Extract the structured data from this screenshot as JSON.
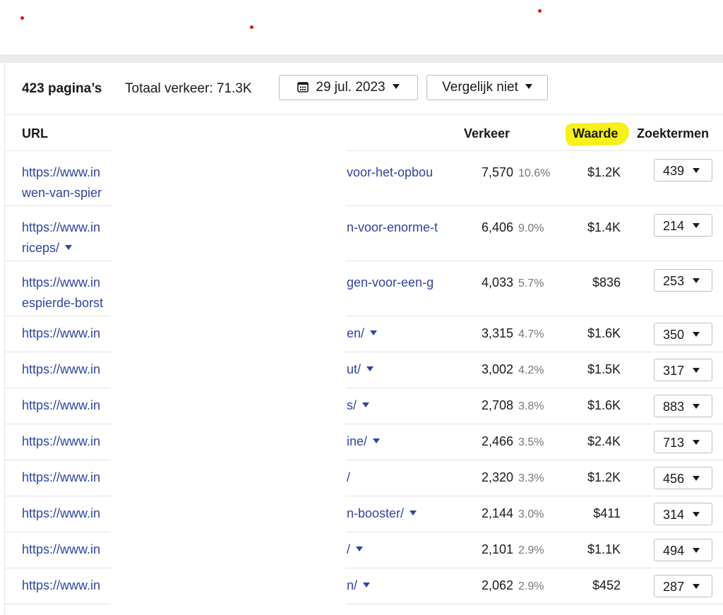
{
  "toolbar": {
    "pages_count": "423 pagina’s",
    "total_traffic": "Totaal verkeer: 71.3K",
    "date": "29 jul. 2023",
    "compare": "Vergelijk niet",
    "date_icon": "calendar-icon",
    "dropdown_icon": "caret-down-icon"
  },
  "table": {
    "headers": {
      "url": "URL",
      "traffic": "Verkeer",
      "value": "Waarde",
      "keywords": "Zoektermen"
    },
    "rows": [
      {
        "url_start": "https://www.in",
        "url_start_2": "wen-van-spier",
        "url_end": "voor-het-opbou",
        "traffic": "7,570",
        "pct": "10.6%",
        "value": "$1.2K",
        "keywords": "439"
      },
      {
        "url_start": "https://www.in",
        "url_start_2": "riceps/",
        "url_end": "n-voor-enorme-t",
        "traffic": "6,406",
        "pct": "9.0%",
        "value": "$1.4K",
        "keywords": "214"
      },
      {
        "url_start": "https://www.in",
        "url_start_2": "espierde-borst",
        "url_end": "gen-voor-een-g",
        "traffic": "4,033",
        "pct": "5.7%",
        "value": "$836",
        "keywords": "253"
      },
      {
        "url_start": "https://www.in",
        "url_end": "en/",
        "traffic": "3,315",
        "pct": "4.7%",
        "value": "$1.6K",
        "keywords": "350"
      },
      {
        "url_start": "https://www.in",
        "url_end": "ut/",
        "traffic": "3,002",
        "pct": "4.2%",
        "value": "$1.5K",
        "keywords": "317"
      },
      {
        "url_start": "https://www.in",
        "url_end": "s/",
        "traffic": "2,708",
        "pct": "3.8%",
        "value": "$1.6K",
        "keywords": "883"
      },
      {
        "url_start": "https://www.in",
        "url_end": "ine/",
        "traffic": "2,466",
        "pct": "3.5%",
        "value": "$2.4K",
        "keywords": "713"
      },
      {
        "url_start": "https://www.in",
        "url_end": "/",
        "traffic": "2,320",
        "pct": "3.3%",
        "value": "$1.2K",
        "keywords": "456"
      },
      {
        "url_start": "https://www.in",
        "url_end": "n-booster/",
        "traffic": "2,144",
        "pct": "3.0%",
        "value": "$411",
        "keywords": "314"
      },
      {
        "url_start": "https://www.in",
        "url_end": "/",
        "traffic": "2,101",
        "pct": "2.9%",
        "value": "$1.1K",
        "keywords": "494"
      },
      {
        "url_start": "https://www.in",
        "url_end": "n/",
        "traffic": "2,062",
        "pct": "2.9%",
        "value": "$452",
        "keywords": "287"
      }
    ]
  },
  "colors": {
    "link": "#2f45a0",
    "highlight": "#f7f01a",
    "marker_dot": "#d71920"
  }
}
